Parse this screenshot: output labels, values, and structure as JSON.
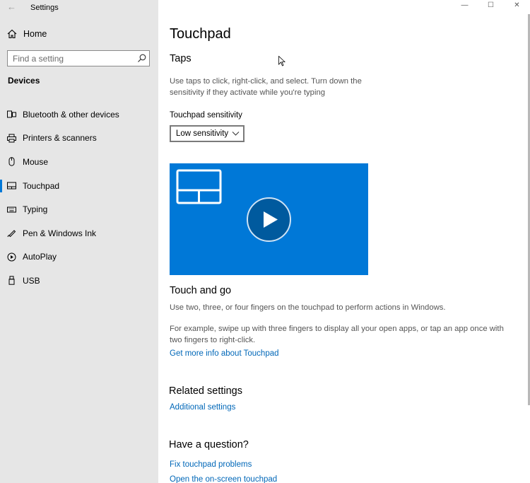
{
  "window": {
    "title": "Settings",
    "controls": {
      "minimize": "—",
      "maximize": "☐",
      "close": "✕"
    }
  },
  "sidebar": {
    "back_icon": "←",
    "home_label": "Home",
    "search": {
      "placeholder": "Find a setting",
      "value": ""
    },
    "section": "Devices",
    "items": [
      {
        "label": "Bluetooth & other devices",
        "icon": "bluetooth-icon",
        "active": false
      },
      {
        "label": "Printers & scanners",
        "icon": "printer-icon",
        "active": false
      },
      {
        "label": "Mouse",
        "icon": "mouse-icon",
        "active": false
      },
      {
        "label": "Touchpad",
        "icon": "touchpad-icon",
        "active": true
      },
      {
        "label": "Typing",
        "icon": "keyboard-icon",
        "active": false
      },
      {
        "label": "Pen & Windows Ink",
        "icon": "pen-icon",
        "active": false
      },
      {
        "label": "AutoPlay",
        "icon": "autoplay-icon",
        "active": false
      },
      {
        "label": "USB",
        "icon": "usb-icon",
        "active": false
      }
    ]
  },
  "main": {
    "title": "Touchpad",
    "taps": {
      "heading": "Taps",
      "description_line1": "Use taps to click, right-click, and select. Turn down the",
      "description_line2": "sensitivity if they activate while you're typing",
      "sensitivity_label": "Touchpad sensitivity",
      "sensitivity_value": "Low sensitivity"
    },
    "video": {
      "icon": "play-icon"
    },
    "touch_and_go": {
      "heading": "Touch and go",
      "description": "Use two, three, or four fingers on the touchpad to perform actions in Windows.",
      "example_line1": "For example, swipe up with three fingers to display all your open apps, or tap an app once with",
      "example_line2": "two fingers to right-click.",
      "link": "Get more info about Touchpad"
    },
    "related": {
      "heading": "Related settings",
      "link": "Additional settings"
    },
    "question": {
      "heading": "Have a question?",
      "links": [
        "Fix touchpad problems",
        "Open the on-screen touchpad"
      ]
    }
  },
  "colors": {
    "accent": "#0078d7",
    "link": "#0067b8",
    "sidebar_bg": "#e6e6e6"
  }
}
